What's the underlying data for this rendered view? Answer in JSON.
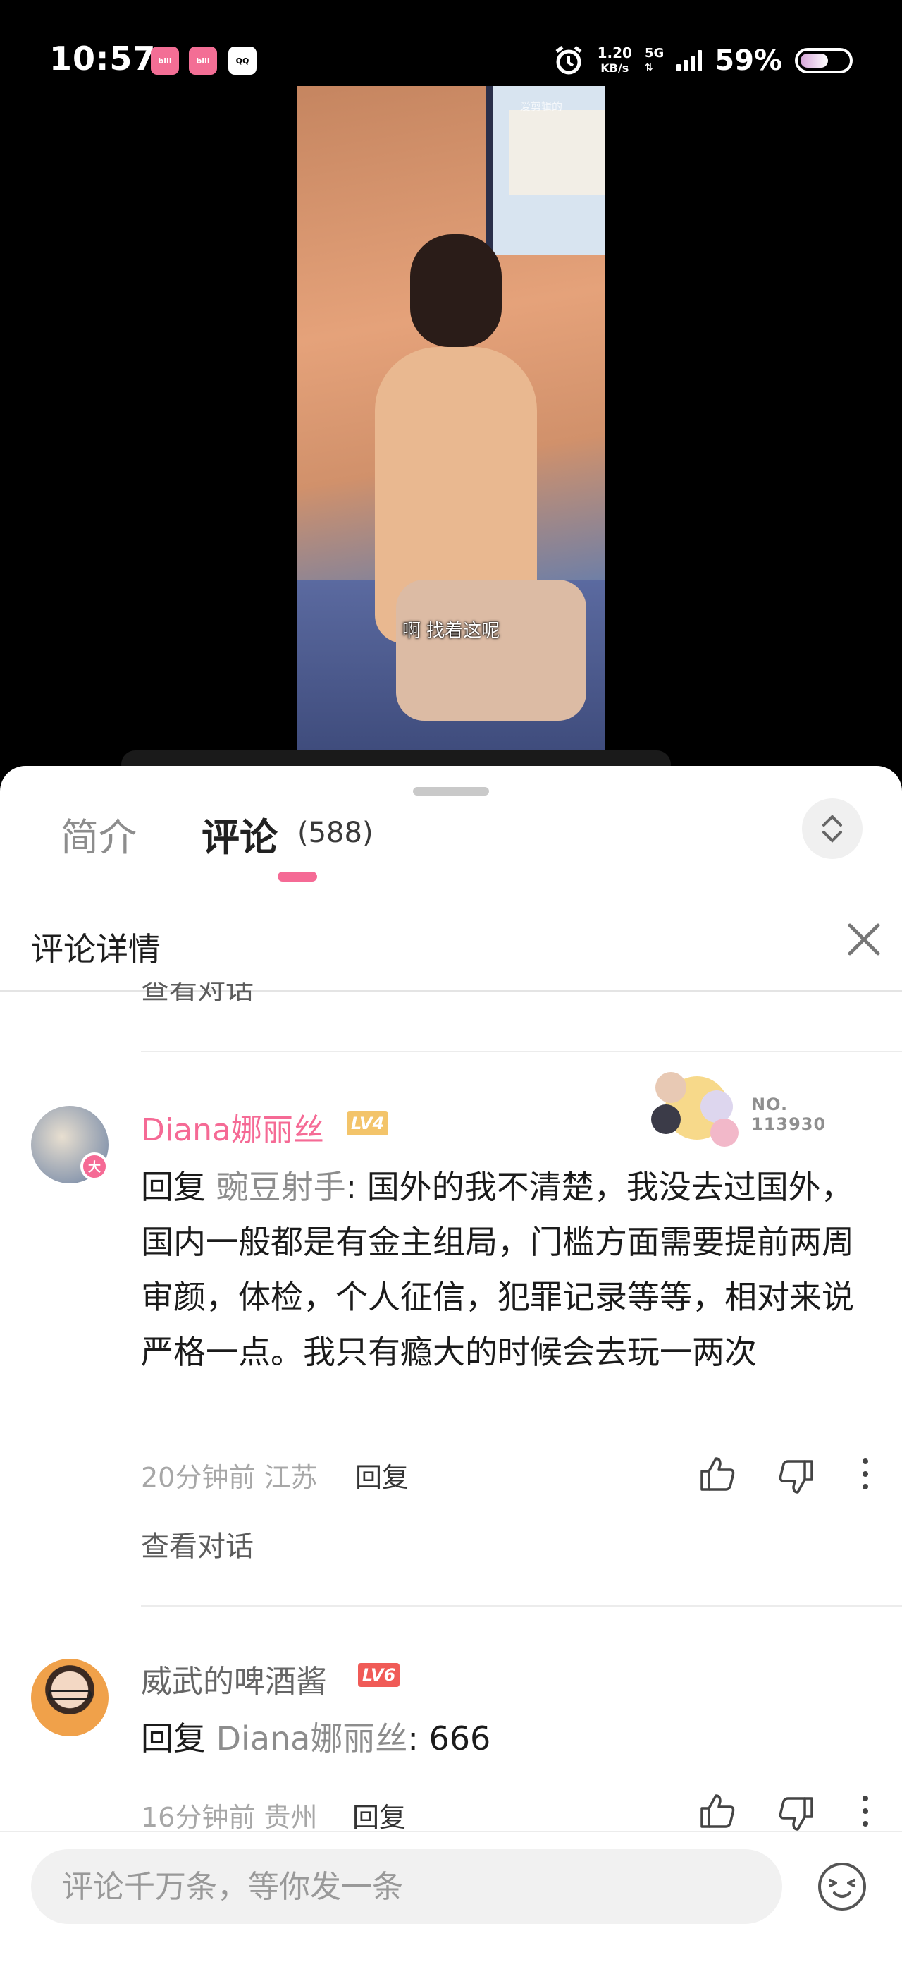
{
  "status_bar": {
    "time": "10:57",
    "apps": [
      "bilibili",
      "bilibili",
      "QQ"
    ],
    "speed_value": "1.20",
    "speed_unit": "KB/s",
    "network": "5G",
    "battery_pct": "59%"
  },
  "video": {
    "subtitle": "啊 找着这呢",
    "watermark": "爱剪辑的"
  },
  "tabs": {
    "intro": "简介",
    "comments": "评论",
    "comments_count": "(588)"
  },
  "detail": {
    "title": "评论详情"
  },
  "cut_link": "查看对话",
  "comments": [
    {
      "username": "Diana娜丽丝",
      "level": "LV4",
      "avatar_badge": "大",
      "fan_number": "NO.\n113930",
      "reply_prefix": "回复",
      "reply_target": "豌豆射手",
      "text": ": 国外的我不清楚，我没去过国外，国内一般都是有金主组局，门槛方面需要提前两周审颜，体检，个人征信，犯罪记录等等，相对来说严格一点。我只有瘾大的时候会去玩一两次",
      "time": "20分钟前",
      "location": "江苏",
      "reply_label": "回复",
      "view_thread": "查看对话"
    },
    {
      "username": "威武的啤酒酱",
      "level": "LV6",
      "reply_prefix": "回复",
      "reply_target": "Diana娜丽丝",
      "text": ": 666",
      "time": "16分钟前",
      "location": "贵州",
      "reply_label": "回复"
    }
  ],
  "input": {
    "placeholder": "评论千万条，等你发一条"
  },
  "colors": {
    "accent": "#f56a95",
    "lv4": "#f3c46a",
    "lv6": "#f05b57"
  },
  "icons": [
    "alarm-icon",
    "signal-icon",
    "battery-icon",
    "expand-icon",
    "close-icon",
    "like-icon",
    "dislike-icon",
    "more-icon",
    "emoji-icon"
  ]
}
